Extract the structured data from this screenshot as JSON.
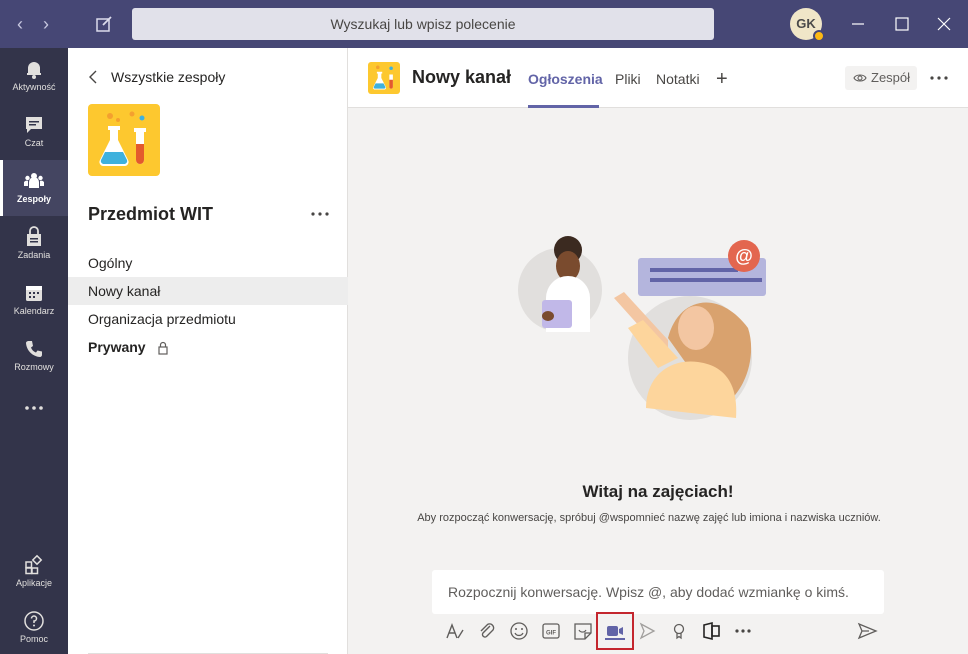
{
  "titlebar": {
    "search_placeholder": "Wyszukaj lub wpisz polecenie",
    "user_initials": "GK",
    "presence_color": "#fdb913"
  },
  "rail": {
    "items": [
      {
        "label": "Aktywność",
        "icon": "bell-icon"
      },
      {
        "label": "Czat",
        "icon": "chat-icon"
      },
      {
        "label": "Zespoły",
        "icon": "teams-icon",
        "active": true
      },
      {
        "label": "Zadania",
        "icon": "assignments-icon"
      },
      {
        "label": "Kalendarz",
        "icon": "calendar-icon"
      },
      {
        "label": "Rozmowy",
        "icon": "phone-icon"
      },
      {
        "label": "Aplikacje",
        "icon": "apps-icon"
      },
      {
        "label": "Pomoc",
        "icon": "help-icon"
      }
    ]
  },
  "panel": {
    "back_label": "Wszystkie zespoły",
    "team_name": "Przedmiot WIT",
    "channels": [
      {
        "name": "Ogólny"
      },
      {
        "name": "Nowy kanał",
        "selected": true
      },
      {
        "name": "Organizacja przedmiotu"
      },
      {
        "name": "Prywany",
        "private": true
      }
    ]
  },
  "main": {
    "channel_title": "Nowy kanał",
    "tabs": [
      {
        "label": "Ogłoszenia",
        "active": true
      },
      {
        "label": "Pliki"
      },
      {
        "label": "Notatki"
      }
    ],
    "team_button": "Zespół",
    "welcome_title": "Witaj na zajęciach!",
    "welcome_subtitle": "Aby rozpocząć konwersację, spróbuj @wspomnieć nazwę zajęć lub imiona i nazwiska uczniów.",
    "compose_placeholder": "Rozpocznij konwersację. Wpisz @, aby dodać wzmiankę o kimś.",
    "toolbar_icons": [
      "format-icon",
      "attach-icon",
      "emoji-icon",
      "gif-icon",
      "sticker-icon",
      "meet-now-icon",
      "stream-icon",
      "praise-icon",
      "forms-icon",
      "more-options-icon"
    ],
    "highlighted_tool": "meet-now-icon"
  },
  "colors": {
    "titlebar": "#464775",
    "rail": "#33344a",
    "accent": "#6264a7",
    "team_logo_bg": "#fdc82f",
    "highlight": "#c4262e"
  }
}
